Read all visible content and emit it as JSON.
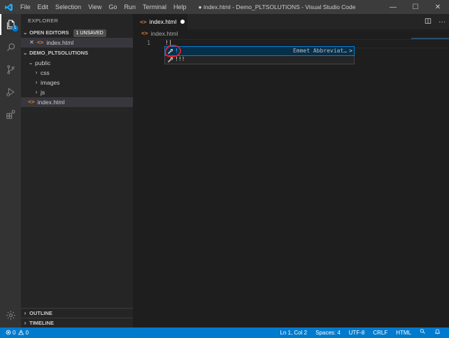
{
  "titlebar": {
    "menus": [
      "File",
      "Edit",
      "Selection",
      "View",
      "Go",
      "Run",
      "Terminal",
      "Help"
    ],
    "window_title": "● index.html - Demo_PLTSOLUTIONS - Visual Studio Code",
    "minimize": "—",
    "maximize": "☐",
    "close": "✕"
  },
  "activitybar": {
    "icons": [
      "files-icon",
      "search-icon",
      "source-control-icon",
      "run-debug-icon",
      "extensions-icon",
      "manage-gear-icon"
    ],
    "explorer_badge": "1"
  },
  "sidebar": {
    "title": "EXPLORER",
    "open_editors": {
      "label": "OPEN EDITORS",
      "badge": "1 UNSAVED",
      "files": [
        {
          "name": "index.html"
        }
      ]
    },
    "folder": {
      "label": "DEMO_PLTSOLUTIONS",
      "items": [
        {
          "name": "public",
          "expanded": true,
          "depth": 0
        },
        {
          "name": "css",
          "expanded": false,
          "depth": 1
        },
        {
          "name": "images",
          "expanded": false,
          "depth": 1
        },
        {
          "name": "js",
          "expanded": false,
          "depth": 1
        }
      ],
      "file": "index.html"
    },
    "outline_label": "OUTLINE",
    "timeline_label": "TIMELINE"
  },
  "editor": {
    "tab_label": "index.html",
    "breadcrumb": "index.html",
    "line_number": "1",
    "code": "!",
    "suggestions": [
      {
        "label": "!",
        "detail": "Emmet Abbreviat…",
        "more": ">"
      },
      {
        "label": "!!!",
        "detail": ""
      }
    ]
  },
  "statusbar": {
    "errors": "0",
    "warnings": "0",
    "position": "Ln 1, Col 2",
    "spaces": "Spaces: 4",
    "encoding": "UTF-8",
    "eol": "CRLF",
    "language": "HTML"
  },
  "colors": {
    "accent": "#007acc",
    "html_icon": "#e37933",
    "annotation_circle": "#e8202a"
  }
}
